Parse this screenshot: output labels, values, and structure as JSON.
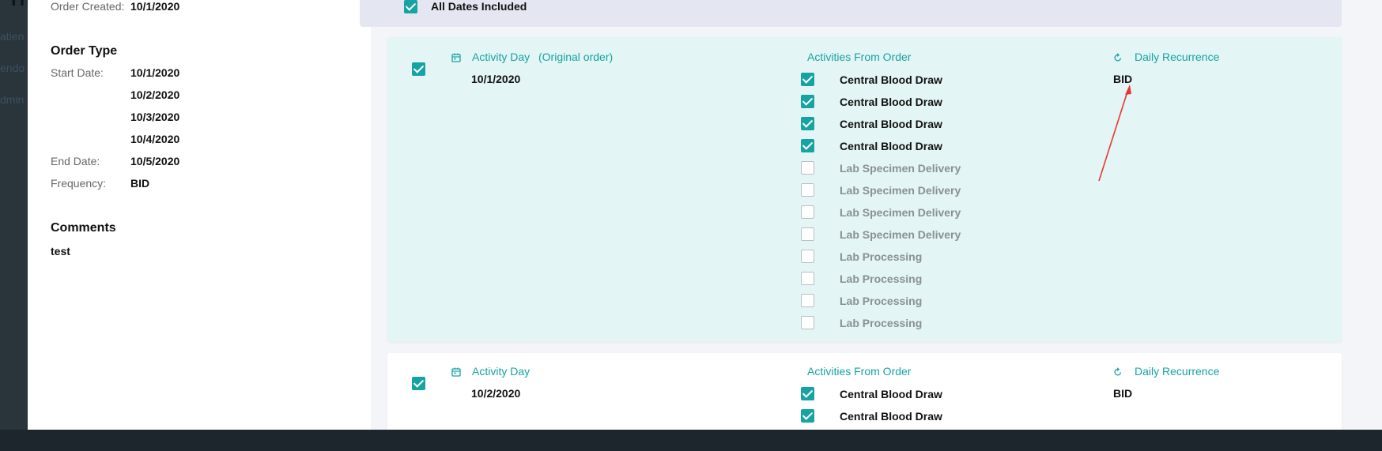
{
  "backdrop": {
    "title": "Th",
    "nav": [
      "atien",
      "endo",
      "dmin"
    ]
  },
  "order": {
    "created_label": "Order Created:",
    "created_value": "10/1/2020",
    "type_title": "Order Type",
    "start_label": "Start Date:",
    "start_dates": [
      "10/1/2020",
      "10/2/2020",
      "10/3/2020",
      "10/4/2020"
    ],
    "end_label": "End Date:",
    "end_value": "10/5/2020",
    "frequency_label": "Frequency:",
    "frequency_value": "BID",
    "comments_title": "Comments",
    "comments_value": "test"
  },
  "all_dates": {
    "label": "All Dates Included",
    "checked": true
  },
  "cards": [
    {
      "day_heading": "Activity Day",
      "day_note": "(Original order)",
      "date": "10/1/2020",
      "activities_heading": "Activities From Order",
      "recurrence_heading": "Daily Recurrence",
      "recurrence_value": "BID",
      "checked": true,
      "activities": [
        {
          "label": "Central Blood Draw",
          "checked": true
        },
        {
          "label": "Central Blood Draw",
          "checked": true
        },
        {
          "label": "Central Blood Draw",
          "checked": true
        },
        {
          "label": "Central Blood Draw",
          "checked": true
        },
        {
          "label": "Lab Specimen Delivery",
          "checked": false
        },
        {
          "label": "Lab Specimen Delivery",
          "checked": false
        },
        {
          "label": "Lab Specimen Delivery",
          "checked": false
        },
        {
          "label": "Lab Specimen Delivery",
          "checked": false
        },
        {
          "label": "Lab Processing",
          "checked": false
        },
        {
          "label": "Lab Processing",
          "checked": false
        },
        {
          "label": "Lab Processing",
          "checked": false
        },
        {
          "label": "Lab Processing",
          "checked": false
        }
      ]
    },
    {
      "day_heading": "Activity Day",
      "date": "10/2/2020",
      "activities_heading": "Activities From Order",
      "recurrence_heading": "Daily Recurrence",
      "recurrence_value": "BID",
      "checked": true,
      "activities": [
        {
          "label": "Central Blood Draw",
          "checked": true
        },
        {
          "label": "Central Blood Draw",
          "checked": true
        }
      ]
    }
  ],
  "colors": {
    "accent": "#16a3a3",
    "highlight_card": "#e3f5f4",
    "annotation": "#e8372c"
  }
}
